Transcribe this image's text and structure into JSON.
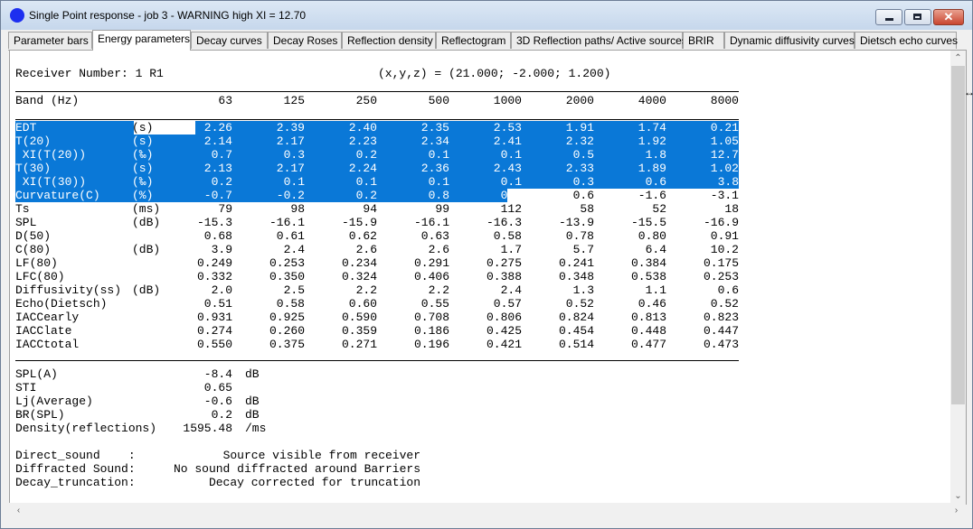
{
  "window": {
    "title": "Single Point response - job 3 - WARNING high XI = 12.70"
  },
  "tabs": [
    "Parameter bars",
    "Energy parameters",
    "Decay curves",
    "Decay Roses",
    "Reflection density",
    "Reflectogram",
    "3D Reflection paths/ Active sources",
    "BRIR",
    "Dynamic diffusivity curves",
    "Dietsch echo curves"
  ],
  "active_tab": "Energy parameters",
  "receiver": {
    "label": "Receiver Number: 1 R1",
    "coords": "(x,y,z) = (21.000; -2.000; 1.200)"
  },
  "band": {
    "label": "Band (Hz)",
    "freqs": [
      "63",
      "125",
      "250",
      "500",
      "1000",
      "2000",
      "4000",
      "8000"
    ]
  },
  "rows": [
    {
      "name": "EDT",
      "unit": "(s)",
      "vals": [
        "2.26",
        "2.39",
        "2.40",
        "2.35",
        "2.53",
        "1.91",
        "1.74",
        "0.21"
      ]
    },
    {
      "name": "T(20)",
      "unit": "(s)",
      "vals": [
        "2.14",
        "2.17",
        "2.23",
        "2.34",
        "2.41",
        "2.32",
        "1.92",
        "1.05"
      ]
    },
    {
      "name": " XI(T(20))",
      "unit": "(‰)",
      "vals": [
        "0.7",
        "0.3",
        "0.2",
        "0.1",
        "0.1",
        "0.5",
        "1.8",
        "12.7"
      ]
    },
    {
      "name": "T(30)",
      "unit": "(s)",
      "vals": [
        "2.13",
        "2.17",
        "2.24",
        "2.36",
        "2.43",
        "2.33",
        "1.89",
        "1.02"
      ]
    },
    {
      "name": " XI(T(30))",
      "unit": "(‰)",
      "vals": [
        "0.2",
        "0.1",
        "0.1",
        "0.1",
        "0.1",
        "0.3",
        "0.6",
        "3.8"
      ]
    },
    {
      "name": "Curvature(C)",
      "unit": "(%)",
      "vals": [
        "-0.7",
        "-0.2",
        "0.2",
        "0.8",
        "0.9",
        "0.6",
        "-1.6",
        "-3.1"
      ]
    },
    {
      "name": "Ts",
      "unit": "(ms)",
      "vals": [
        "79",
        "98",
        "94",
        "99",
        "112",
        "58",
        "52",
        "18"
      ]
    },
    {
      "name": "SPL",
      "unit": "(dB)",
      "vals": [
        "-15.3",
        "-16.1",
        "-15.9",
        "-16.1",
        "-16.3",
        "-13.9",
        "-15.5",
        "-16.9"
      ]
    },
    {
      "name": "D(50)",
      "unit": "",
      "vals": [
        "0.68",
        "0.61",
        "0.62",
        "0.63",
        "0.58",
        "0.78",
        "0.80",
        "0.91"
      ]
    },
    {
      "name": "C(80)",
      "unit": "(dB)",
      "vals": [
        "3.9",
        "2.4",
        "2.6",
        "2.6",
        "1.7",
        "5.7",
        "6.4",
        "10.2"
      ]
    },
    {
      "name": "LF(80)",
      "unit": "",
      "vals": [
        "0.249",
        "0.253",
        "0.234",
        "0.291",
        "0.275",
        "0.241",
        "0.384",
        "0.175"
      ]
    },
    {
      "name": "LFC(80)",
      "unit": "",
      "vals": [
        "0.332",
        "0.350",
        "0.324",
        "0.406",
        "0.388",
        "0.348",
        "0.538",
        "0.253"
      ]
    },
    {
      "name": "Diffusivity(ss)",
      "unit": "(dB)",
      "vals": [
        "2.0",
        "2.5",
        "2.2",
        "2.2",
        "2.4",
        "1.3",
        "1.1",
        "0.6"
      ]
    },
    {
      "name": "Echo(Dietsch)",
      "unit": "",
      "vals": [
        "0.51",
        "0.58",
        "0.60",
        "0.55",
        "0.57",
        "0.52",
        "0.46",
        "0.52"
      ]
    },
    {
      "name": "IACCearly",
      "unit": "",
      "vals": [
        "0.931",
        "0.925",
        "0.590",
        "0.708",
        "0.806",
        "0.824",
        "0.813",
        "0.823"
      ]
    },
    {
      "name": "IACClate",
      "unit": "",
      "vals": [
        "0.274",
        "0.260",
        "0.359",
        "0.186",
        "0.425",
        "0.454",
        "0.448",
        "0.447"
      ]
    },
    {
      "name": "IACCtotal",
      "unit": "",
      "vals": [
        "0.550",
        "0.375",
        "0.271",
        "0.196",
        "0.421",
        "0.514",
        "0.477",
        "0.473"
      ]
    }
  ],
  "summary": [
    {
      "label": "SPL(A)",
      "value": "-8.4",
      "unit": "dB"
    },
    {
      "label": "STI",
      "value": "0.65",
      "unit": ""
    },
    {
      "label": "Lj(Average)",
      "value": "-0.6",
      "unit": "dB"
    },
    {
      "label": "BR(SPL)",
      "value": "0.2",
      "unit": "dB"
    },
    {
      "label": "Density(reflections)",
      "value": "1595.48",
      "unit": "/ms"
    }
  ],
  "notes": [
    {
      "label": "Direct_sound    :",
      "text": "Source visible from receiver"
    },
    {
      "label": "Diffracted Sound:",
      "text": "No sound diffracted around Barriers"
    },
    {
      "label": "Decay_truncation:",
      "text": "Decay corrected for truncation"
    }
  ],
  "selection": {
    "rows_fully_selected": 5,
    "last_row_partial_columns": 5,
    "color": "#0a78d7"
  },
  "icons": [
    "app-icon",
    "minimize-icon",
    "maximize-icon",
    "close-icon",
    "scroll-up-arrow",
    "scroll-down-arrow",
    "scroll-left-arrow",
    "scroll-right-arrow",
    "resize-cursor"
  ]
}
